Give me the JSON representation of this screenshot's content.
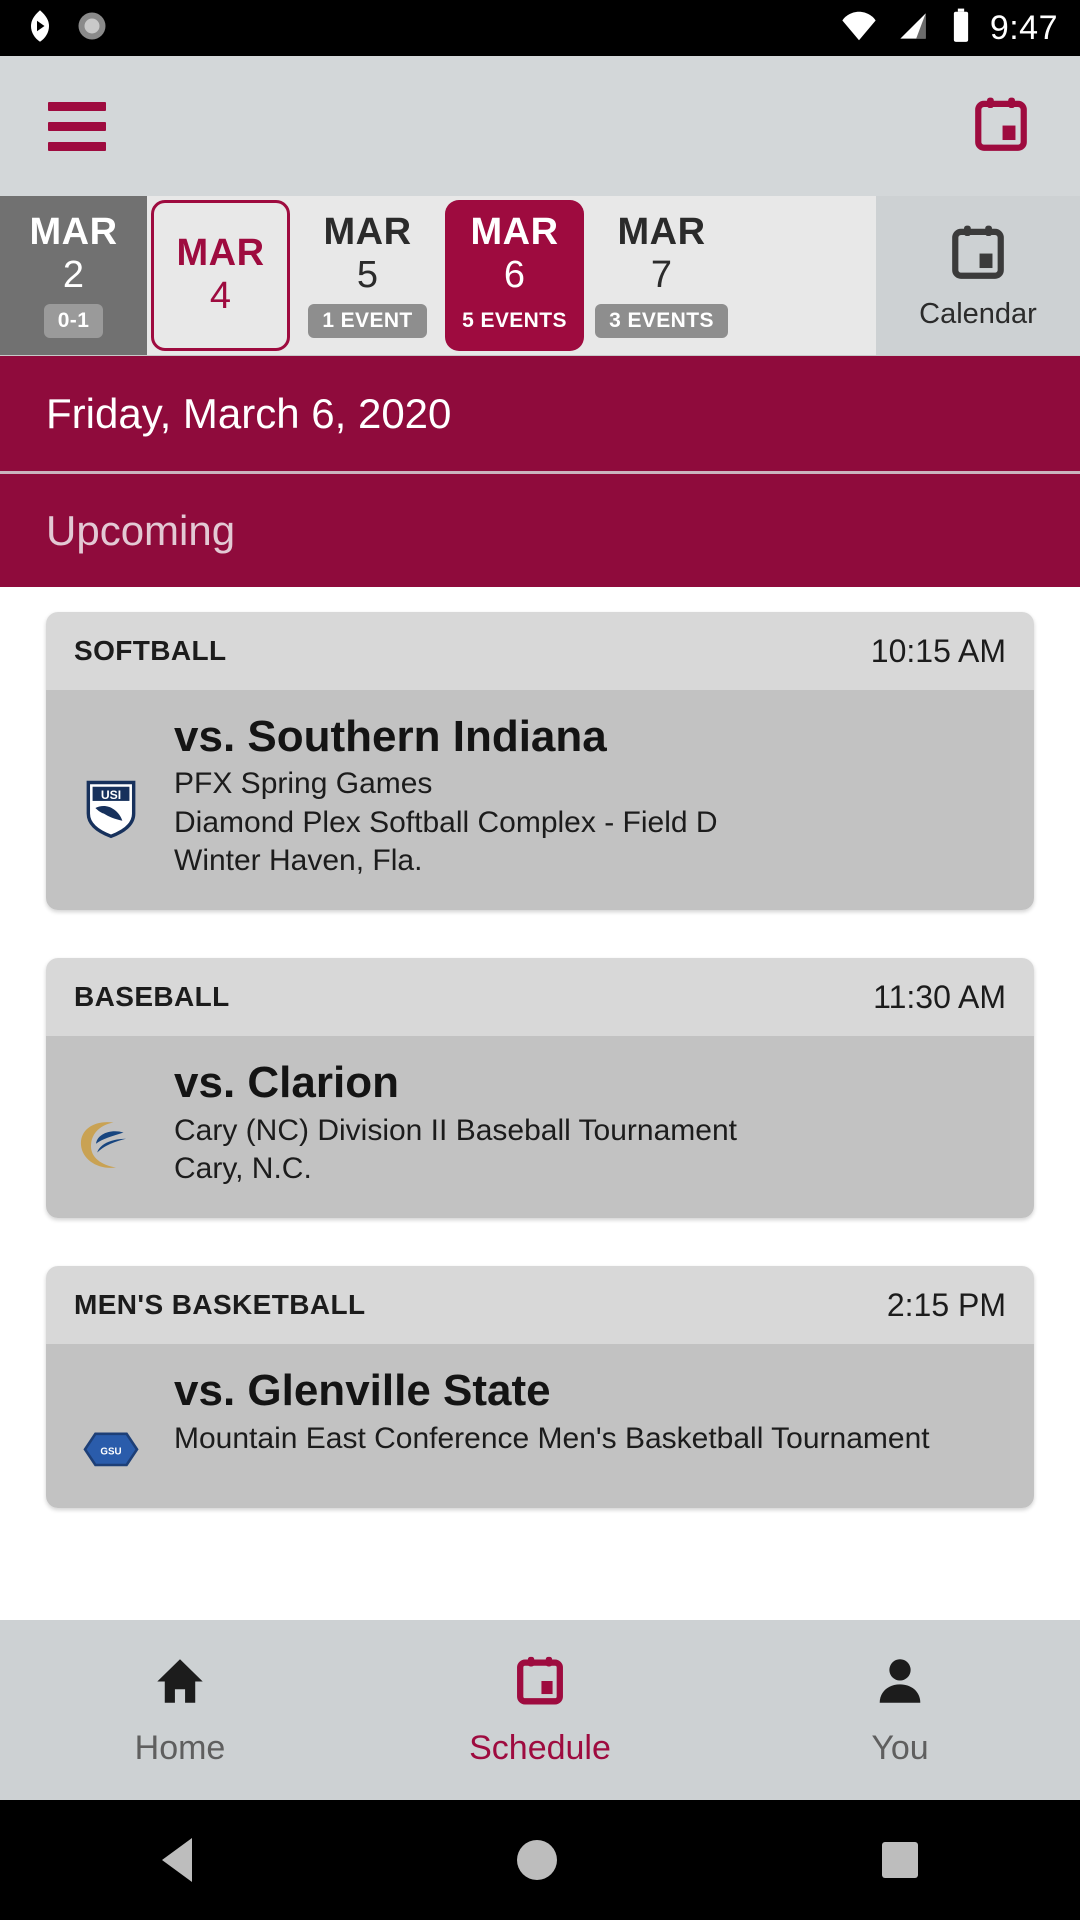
{
  "status_bar": {
    "time": "9:47",
    "icons": [
      "play-store-icon",
      "settings-sync-icon",
      "wifi-icon",
      "cell-signal-icon",
      "battery-icon"
    ]
  },
  "app_bar": {
    "menu_icon": "hamburger-menu-icon",
    "calendar_icon": "calendar-icon"
  },
  "date_strip": {
    "dates": [
      {
        "month": "MAR",
        "day": "2",
        "badge": "0-1",
        "state": "past"
      },
      {
        "month": "MAR",
        "day": "4",
        "badge": "",
        "state": "today"
      },
      {
        "month": "MAR",
        "day": "5",
        "badge": "1 EVENT",
        "state": "normal"
      },
      {
        "month": "MAR",
        "day": "6",
        "badge": "5 EVENTS",
        "state": "selected"
      },
      {
        "month": "MAR",
        "day": "7",
        "badge": "3 EVENTS",
        "state": "normal"
      }
    ],
    "calendar_tab": {
      "label": "Calendar",
      "icon": "calendar-icon"
    }
  },
  "date_header": {
    "text": "Friday, March 6, 2020"
  },
  "section_header": {
    "text": "Upcoming"
  },
  "events": [
    {
      "sport": "SOFTBALL",
      "time": "10:15 AM",
      "opponent": "vs. Southern Indiana",
      "meta_lines": [
        "PFX Spring Games",
        "Diamond Plex Softball Complex - Field D",
        "Winter Haven, Fla."
      ],
      "logo": "usi-screaming-eagles-logo"
    },
    {
      "sport": "BASEBALL",
      "time": "11:30 AM",
      "opponent": "vs. Clarion",
      "meta_lines": [
        "Cary (NC) Division II Baseball Tournament",
        "Cary, N.C."
      ],
      "logo": "clarion-golden-eagles-logo"
    },
    {
      "sport": "MEN'S BASKETBALL",
      "time": "2:15 PM",
      "opponent": "vs. Glenville State",
      "meta_lines": [
        "Mountain East Conference Men's Basketball Tournament"
      ],
      "logo": "glenville-state-pioneers-logo"
    }
  ],
  "bottom_nav": [
    {
      "label": "Home",
      "icon": "home-icon",
      "active": false
    },
    {
      "label": "Schedule",
      "icon": "calendar-icon",
      "active": true
    },
    {
      "label": "You",
      "icon": "person-icon",
      "active": false
    }
  ],
  "android_nav": {
    "back": "back-triangle-icon",
    "home": "home-circle-icon",
    "recents": "recents-square-icon"
  },
  "colors": {
    "brand": "#9e0b3f",
    "header": "#8f0b3c",
    "app_bar_bg": "#d3d7d9",
    "card_head": "#d8d8d8",
    "card_body": "#c2c2c2"
  }
}
